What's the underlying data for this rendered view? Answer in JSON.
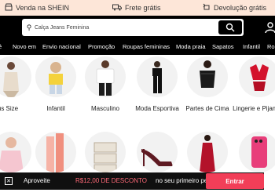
{
  "promo": {
    "items": [
      {
        "label": "Venda na SHEIN",
        "icon": "store-icon"
      },
      {
        "label": "Frete grátis",
        "icon": "truck-icon"
      },
      {
        "label": "Devolução grátis",
        "icon": "return-icon"
      }
    ]
  },
  "header": {
    "search_placeholder": "Calça Jeans Feminina"
  },
  "categories": [
    "ê",
    "Novo em",
    "Envio nacional",
    "Promoção",
    "Roupas femininas",
    "Moda praia",
    "Sapatos",
    "Infantil",
    "Ro"
  ],
  "grid": {
    "row1": [
      {
        "label": "us Size"
      },
      {
        "label": "Infantil"
      },
      {
        "label": "Masculino"
      },
      {
        "label": "Moda Esportiva"
      },
      {
        "label": "Partes de Cima"
      },
      {
        "label": "Lingerie e Pijamas"
      }
    ]
  },
  "bottom_bar": {
    "text_before": "Aproveite",
    "highlight": "R$12,00 DE DESCONTO",
    "text_after": "no seu primeiro pedido!",
    "button": "Entrar",
    "accent": "#f23e58"
  }
}
